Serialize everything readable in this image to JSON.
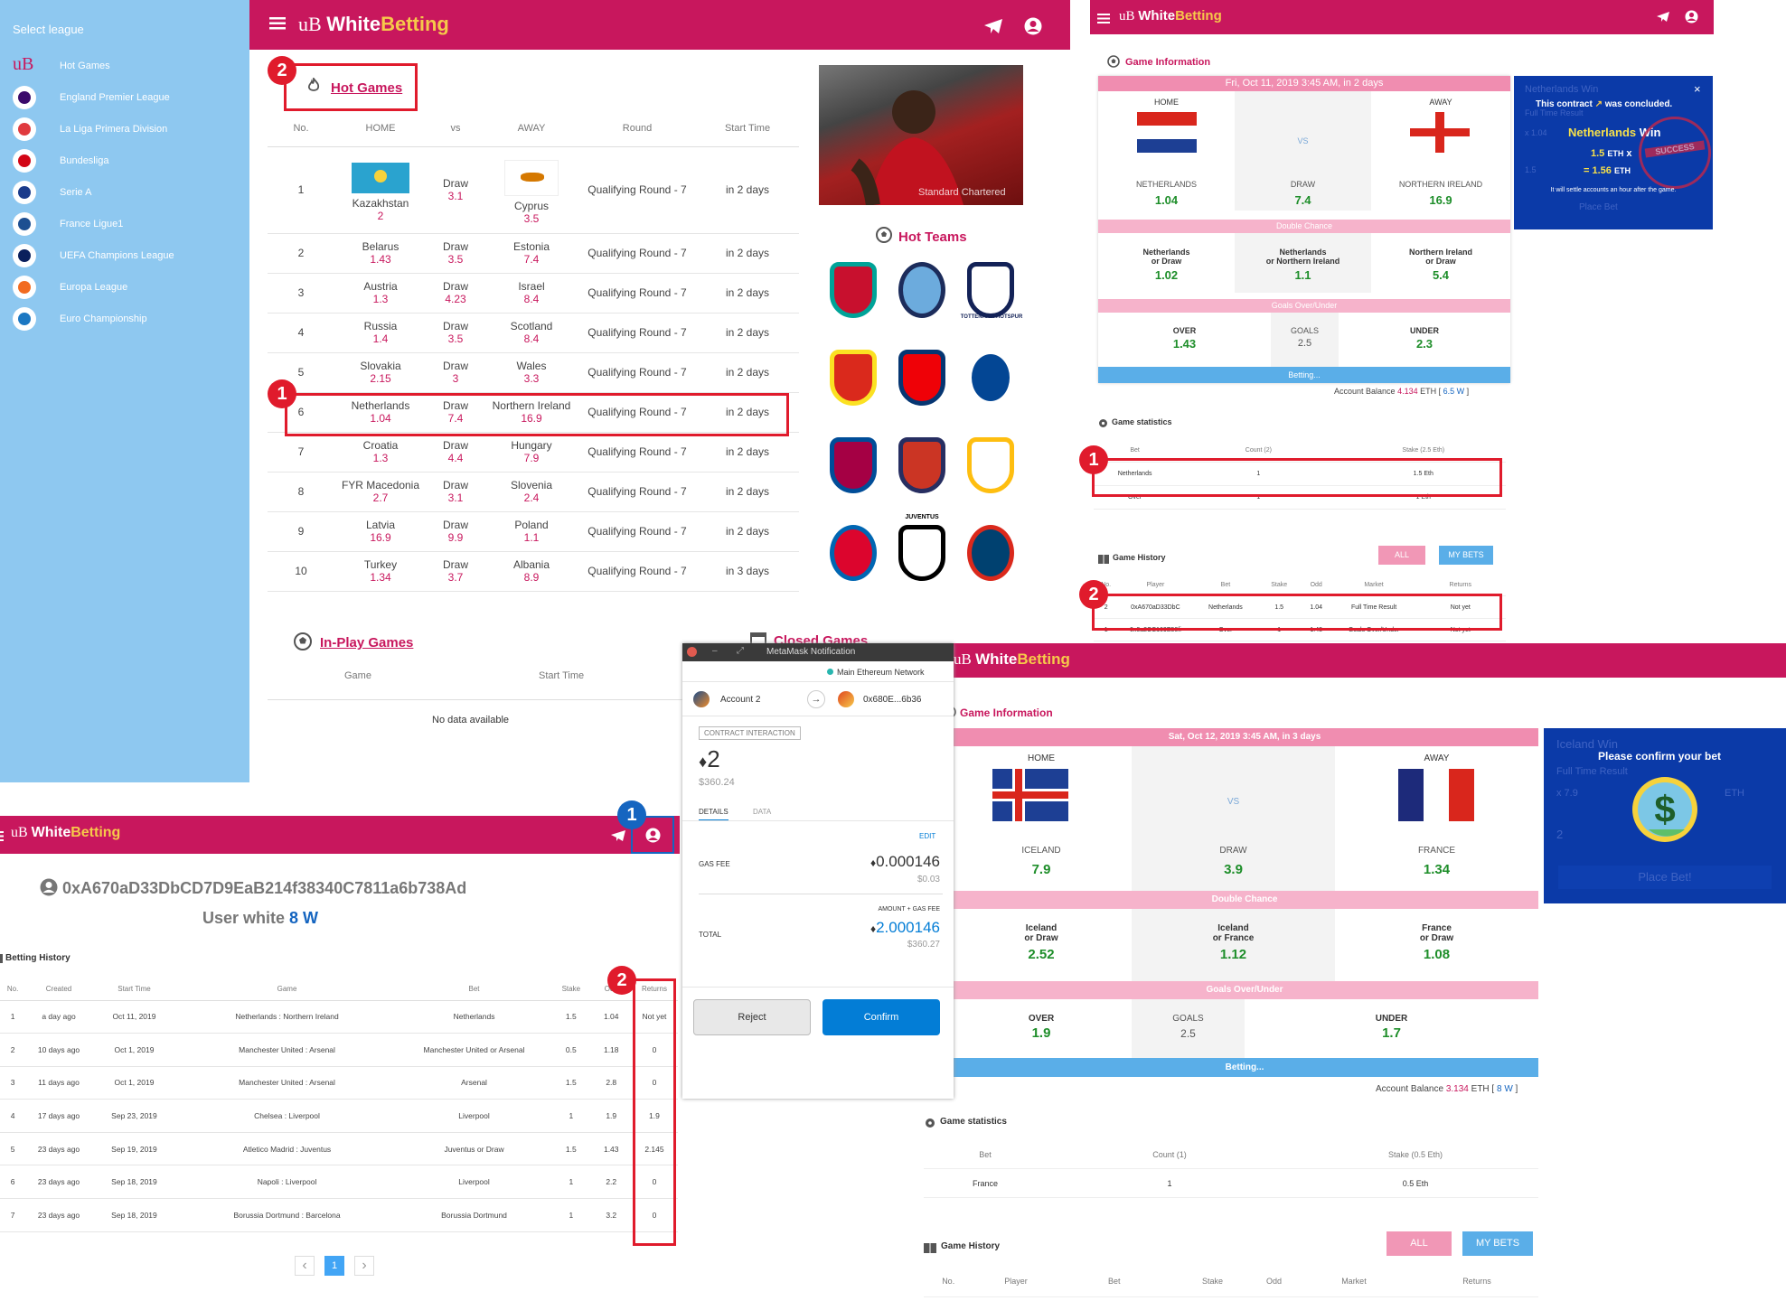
{
  "brand": {
    "prefix": "uB",
    "white": "White",
    "betting": "Betting"
  },
  "sidebar": {
    "title": "Select league",
    "items": [
      {
        "label": "Hot Games",
        "icon": "ub-logo-icon"
      },
      {
        "label": "England Premier League",
        "icon": "premier-league-icon"
      },
      {
        "label": "La Liga Primera Division",
        "icon": "laliga-icon"
      },
      {
        "label": "Bundesliga",
        "icon": "bundesliga-icon"
      },
      {
        "label": "Serie A",
        "icon": "serie-a-icon"
      },
      {
        "label": "France Ligue1",
        "icon": "ligue1-icon"
      },
      {
        "label": "UEFA Champions League",
        "icon": "champions-league-icon"
      },
      {
        "label": "Europa League",
        "icon": "europa-league-icon"
      },
      {
        "label": "Euro Championship",
        "icon": "euro-icon"
      }
    ]
  },
  "hot_games": {
    "title": "Hot Games",
    "columns": [
      "No.",
      "HOME",
      "vs",
      "AWAY",
      "Round",
      "Start Time"
    ],
    "rows": [
      {
        "no": "1",
        "home": "Kazakhstan",
        "home_odd": "2",
        "draw": "Draw",
        "draw_odd": "3.1",
        "away": "Cyprus",
        "away_odd": "3.5",
        "round": "Qualifying Round - 7",
        "start": "in 2 days"
      },
      {
        "no": "2",
        "home": "Belarus",
        "home_odd": "1.43",
        "draw": "Draw",
        "draw_odd": "3.5",
        "away": "Estonia",
        "away_odd": "7.4",
        "round": "Qualifying Round - 7",
        "start": "in 2 days"
      },
      {
        "no": "3",
        "home": "Austria",
        "home_odd": "1.3",
        "draw": "Draw",
        "draw_odd": "4.23",
        "away": "Israel",
        "away_odd": "8.4",
        "round": "Qualifying Round - 7",
        "start": "in 2 days"
      },
      {
        "no": "4",
        "home": "Russia",
        "home_odd": "1.4",
        "draw": "Draw",
        "draw_odd": "3.5",
        "away": "Scotland",
        "away_odd": "8.4",
        "round": "Qualifying Round - 7",
        "start": "in 2 days"
      },
      {
        "no": "5",
        "home": "Slovakia",
        "home_odd": "2.15",
        "draw": "Draw",
        "draw_odd": "3",
        "away": "Wales",
        "away_odd": "3.3",
        "round": "Qualifying Round - 7",
        "start": "in 2 days"
      },
      {
        "no": "6",
        "home": "Netherlands",
        "home_odd": "1.04",
        "draw": "Draw",
        "draw_odd": "7.4",
        "away": "Northern Ireland",
        "away_odd": "16.9",
        "round": "Qualifying Round - 7",
        "start": "in 2 days"
      },
      {
        "no": "7",
        "home": "Croatia",
        "home_odd": "1.3",
        "draw": "Draw",
        "draw_odd": "4.4",
        "away": "Hungary",
        "away_odd": "7.9",
        "round": "Qualifying Round - 7",
        "start": "in 2 days"
      },
      {
        "no": "8",
        "home": "FYR Macedonia",
        "home_odd": "2.7",
        "draw": "Draw",
        "draw_odd": "3.1",
        "away": "Slovenia",
        "away_odd": "2.4",
        "round": "Qualifying Round - 7",
        "start": "in 2 days"
      },
      {
        "no": "9",
        "home": "Latvia",
        "home_odd": "16.9",
        "draw": "Draw",
        "draw_odd": "9.9",
        "away": "Poland",
        "away_odd": "1.1",
        "round": "Qualifying Round - 7",
        "start": "in 2 days"
      },
      {
        "no": "10",
        "home": "Turkey",
        "home_odd": "1.34",
        "draw": "Draw",
        "draw_odd": "3.7",
        "away": "Albania",
        "away_odd": "8.9",
        "round": "Qualifying Round - 7",
        "start": "in 3 days"
      }
    ]
  },
  "hot_teams": {
    "title": "Hot Teams",
    "teams": [
      "liverpool-crest-icon",
      "man-city-crest-icon",
      "tottenham-crest-icon",
      "man-united-crest-icon",
      "arsenal-crest-icon",
      "chelsea-crest-icon",
      "barcelona-crest-icon",
      "atletico-crest-icon",
      "real-madrid-crest-icon",
      "bayern-crest-icon",
      "juventus-crest-icon",
      "psg-crest-icon"
    ],
    "tottenham_text": "TOTTENHAM HOTSPUR",
    "juventus_text": "JUVENTUS"
  },
  "photo_caption": "Standard Chartered",
  "inplay": {
    "title": "In-Play Games",
    "col_game": "Game",
    "col_start": "Start Time",
    "empty": "No data available"
  },
  "closed": {
    "title": "Closed Games"
  },
  "game1": {
    "section": "Game Information",
    "date": "Fri, Oct 11, 2019 3:45 AM, in 2 days",
    "home_label": "HOME",
    "away_label": "AWAY",
    "vs": "VS",
    "home": "NETHERLANDS",
    "home_odd": "1.04",
    "draw": "DRAW",
    "draw_odd": "7.4",
    "away": "NORTHERN IRELAND",
    "away_odd": "16.9",
    "double_chance": "Double Chance",
    "dc1_a": "Netherlands",
    "dc1_b": "or Draw",
    "dc1_odd": "1.02",
    "dc2_a": "Netherlands",
    "dc2_b": "or Northern Ireland",
    "dc2_odd": "1.1",
    "dc3_a": "Northern Ireland",
    "dc3_b": "or Draw",
    "dc3_odd": "5.4",
    "goals": "Goals Over/Under",
    "over": "OVER",
    "over_odd": "1.43",
    "goals_label": "GOALS",
    "goals_val": "2.5",
    "under": "UNDER",
    "under_odd": "2.3",
    "betting": "Betting...",
    "balance_label": "Account Balance",
    "balance": "4.134",
    "balance_unit": "ETH",
    "balance_w": "6.5 W",
    "stats_title": "Game statistics",
    "stats_cols": [
      "Bet",
      "Count (2)",
      "Stake (2.5 Eth)"
    ],
    "stats_rows": [
      [
        "Netherlands",
        "1",
        "1.5 Eth"
      ],
      [
        "Over",
        "1",
        "1 Eth"
      ]
    ],
    "history_title": "Game History",
    "all": "ALL",
    "my_bets": "MY BETS",
    "history_cols": [
      "No.",
      "Player",
      "Bet",
      "Stake",
      "Odd",
      "Market",
      "Returns"
    ],
    "history_rows": [
      [
        "2",
        "0xA670aD33DbC",
        "Netherlands",
        "1.5",
        "1.04",
        "Full Time Result",
        "Not yet"
      ],
      [
        "1",
        "0x0a2CC169E50fi",
        "Over",
        "1",
        "1.43",
        "Goals Over/Under",
        "Not yet"
      ]
    ]
  },
  "popup1": {
    "bg_title": "Netherlands Win",
    "bg_sub": "Full Time Result",
    "line1": "This contract",
    "line1b": "was concluded.",
    "team": "Netherlands",
    "win": "Win",
    "stake": "1.5",
    "stake_unit": "ETH",
    "x": "x",
    "result": "= 1.56",
    "result_unit": "ETH",
    "note": "It will settle accounts an hour after the game.",
    "bg_btn": "Place Bet",
    "bg_odd": "x 1.04",
    "bg_stake": "1.5",
    "stamp": "SUCCESS",
    "close": "×"
  },
  "user_page": {
    "address": "0xA670aD33DbCD7D9EaB214f38340C7811a6b738Ad",
    "user_label": "User white",
    "balance": "8 W",
    "history_title": "Betting History",
    "cols": [
      "No.",
      "Created",
      "Start Time",
      "Game",
      "Bet",
      "Stake",
      "Odd",
      "Returns"
    ],
    "rows": [
      [
        "1",
        "a day ago",
        "Oct 11, 2019",
        "Netherlands : Northern Ireland",
        "Netherlands",
        "1.5",
        "1.04",
        "Not yet"
      ],
      [
        "2",
        "10 days ago",
        "Oct 1, 2019",
        "Manchester United : Arsenal",
        "Manchester United or Arsenal",
        "0.5",
        "1.18",
        "0"
      ],
      [
        "3",
        "11 days ago",
        "Oct 1, 2019",
        "Manchester United : Arsenal",
        "Arsenal",
        "1.5",
        "2.8",
        "0"
      ],
      [
        "4",
        "17 days ago",
        "Sep 23, 2019",
        "Chelsea : Liverpool",
        "Liverpool",
        "1",
        "1.9",
        "1.9"
      ],
      [
        "5",
        "23 days ago",
        "Sep 19, 2019",
        "Atletico Madrid : Juventus",
        "Juventus or Draw",
        "1.5",
        "1.43",
        "2.145"
      ],
      [
        "6",
        "23 days ago",
        "Sep 18, 2019",
        "Napoli : Liverpool",
        "Liverpool",
        "1",
        "2.2",
        "0"
      ],
      [
        "7",
        "23 days ago",
        "Sep 18, 2019",
        "Borussia Dortmund : Barcelona",
        "Borussia Dortmund",
        "1",
        "3.2",
        "0"
      ]
    ],
    "page": "1",
    "prev": "‹",
    "next": "›"
  },
  "metamask": {
    "title": "MetaMask Notification",
    "network": "Main Ethereum Network",
    "account": "Account 2",
    "to": "0x680E...6b36",
    "badge": "CONTRACT INTERACTION",
    "amount": "2",
    "amount_usd": "$360.24",
    "tab_details": "DETAILS",
    "tab_data": "DATA",
    "edit": "EDIT",
    "gas_label": "GAS FEE",
    "gas": "0.000146",
    "gas_usd": "$0.03",
    "total_caption": "AMOUNT + GAS FEE",
    "total_label": "TOTAL",
    "total": "2.000146",
    "total_usd": "$360.27",
    "reject": "Reject",
    "confirm": "Confirm",
    "win_controls": [
      "×",
      "–",
      "⤢"
    ]
  },
  "game2": {
    "section": "Game Information",
    "date": "Sat, Oct 12, 2019 3:45 AM, in 3 days",
    "home_label": "HOME",
    "away_label": "AWAY",
    "vs": "VS",
    "home": "ICELAND",
    "home_odd": "7.9",
    "draw": "DRAW",
    "draw_odd": "3.9",
    "away": "FRANCE",
    "away_odd": "1.34",
    "double_chance": "Double Chance",
    "dc1_a": "Iceland",
    "dc1_b": "or Draw",
    "dc1_odd": "2.52",
    "dc2_a": "Iceland",
    "dc2_b": "or France",
    "dc2_odd": "1.12",
    "dc3_a": "France",
    "dc3_b": "or Draw",
    "dc3_odd": "1.08",
    "goals": "Goals Over/Under",
    "over": "OVER",
    "over_odd": "1.9",
    "goals_label": "GOALS",
    "goals_val": "2.5",
    "under": "UNDER",
    "under_odd": "1.7",
    "betting": "Betting...",
    "balance_label": "Account Balance",
    "balance": "3.134",
    "balance_unit": "ETH",
    "balance_w": "8 W",
    "stats_title": "Game statistics",
    "stats_cols": [
      "Bet",
      "Count (1)",
      "Stake (0.5 Eth)"
    ],
    "stats_rows": [
      [
        "France",
        "1",
        "0.5 Eth"
      ]
    ],
    "history_title": "Game History",
    "all": "ALL",
    "my_bets": "MY BETS",
    "history_cols": [
      "No.",
      "Player",
      "Bet",
      "Stake",
      "Odd",
      "Market",
      "Returns"
    ]
  },
  "popup2": {
    "bg_title": "Iceland Win",
    "bg_sub": "Full Time Result",
    "title": "Please confirm your bet",
    "bg_odd": "x 7.9",
    "bg_eth": "ETH",
    "bg_stake": "2",
    "bg_btn": "Place Bet!"
  },
  "markers": {
    "one": "1",
    "two": "2"
  }
}
